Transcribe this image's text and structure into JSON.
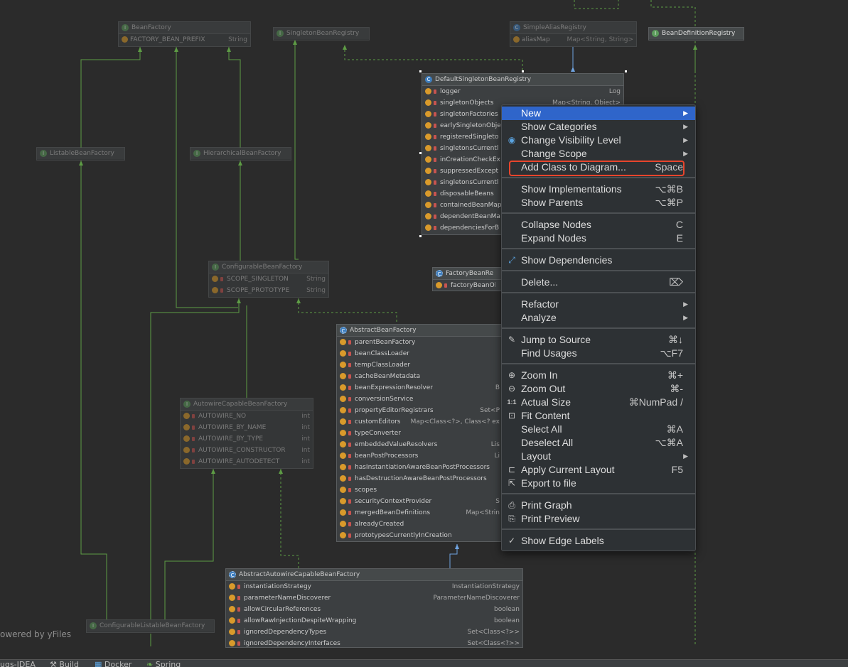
{
  "diagram": {
    "watermark": "owered by yFiles",
    "nodes": {
      "bean_factory": {
        "title": "BeanFactory",
        "fields": [
          {
            "name": "FACTORY_BEAN_PREFIX",
            "type": "String"
          }
        ]
      },
      "singleton_bean_registry": {
        "title": "SingletonBeanRegistry"
      },
      "simple_alias_registry": {
        "title": "SimpleAliasRegistry",
        "fields": [
          {
            "name": "aliasMap",
            "type": "Map<String, String>"
          }
        ]
      },
      "bean_definition_registry": {
        "title": "BeanDefinitionRegistry"
      },
      "listable_bean_factory": {
        "title": "ListableBeanFactory"
      },
      "hierarchical_bean_factory": {
        "title": "HierarchicalBeanFactory"
      },
      "default_singleton_bean_registry": {
        "title": "DefaultSingletonBeanRegistry",
        "fields": [
          {
            "name": "logger",
            "type": "Log"
          },
          {
            "name": "singletonObjects",
            "type": "Map<String, Object>"
          },
          {
            "name": "singletonFactories",
            "type": ""
          },
          {
            "name": "earlySingletonObje",
            "type": ""
          },
          {
            "name": "registeredSingleto",
            "type": ""
          },
          {
            "name": "singletonsCurrentl",
            "type": ""
          },
          {
            "name": "inCreationCheckEx",
            "type": ""
          },
          {
            "name": "suppressedExcept",
            "type": ""
          },
          {
            "name": "singletonsCurrentl",
            "type": ""
          },
          {
            "name": "disposableBeans",
            "type": ""
          },
          {
            "name": "containedBeanMap",
            "type": ""
          },
          {
            "name": "dependentBeanMa",
            "type": ""
          },
          {
            "name": "dependenciesForB",
            "type": ""
          }
        ]
      },
      "configurable_bean_factory": {
        "title": "ConfigurableBeanFactory",
        "fields": [
          {
            "name": "SCOPE_SINGLETON",
            "type": "String"
          },
          {
            "name": "SCOPE_PROTOTYPE",
            "type": "String"
          }
        ]
      },
      "factory_bean_registry": {
        "title": "FactoryBeanRe",
        "fields": [
          {
            "name": "factoryBeanOb",
            "type": ""
          }
        ]
      },
      "abstract_bean_factory": {
        "title": "AbstractBeanFactory",
        "fields": [
          {
            "name": "parentBeanFactory",
            "type": ""
          },
          {
            "name": "beanClassLoader",
            "type": ""
          },
          {
            "name": "tempClassLoader",
            "type": ""
          },
          {
            "name": "cacheBeanMetadata",
            "type": ""
          },
          {
            "name": "beanExpressionResolver",
            "type": "B"
          },
          {
            "name": "conversionService",
            "type": ""
          },
          {
            "name": "propertyEditorRegistrars",
            "type": "Set<P"
          },
          {
            "name": "customEditors",
            "type": "Map<Class<?>, Class<? ex"
          },
          {
            "name": "typeConverter",
            "type": ""
          },
          {
            "name": "embeddedValueResolvers",
            "type": "Lis"
          },
          {
            "name": "beanPostProcessors",
            "type": "Li"
          },
          {
            "name": "hasInstantiationAwareBeanPostProcessors",
            "type": ""
          },
          {
            "name": "hasDestructionAwareBeanPostProcessors",
            "type": ""
          },
          {
            "name": "scopes",
            "type": ""
          },
          {
            "name": "securityContextProvider",
            "type": "S"
          },
          {
            "name": "mergedBeanDefinitions",
            "type": "Map<Strin"
          },
          {
            "name": "alreadyCreated",
            "type": ""
          },
          {
            "name": "prototypesCurrentlyInCreation",
            "type": ""
          }
        ]
      },
      "autowire_capable_bean_factory": {
        "title": "AutowireCapableBeanFactory",
        "fields": [
          {
            "name": "AUTOWIRE_NO",
            "type": "int"
          },
          {
            "name": "AUTOWIRE_BY_NAME",
            "type": "int"
          },
          {
            "name": "AUTOWIRE_BY_TYPE",
            "type": "int"
          },
          {
            "name": "AUTOWIRE_CONSTRUCTOR",
            "type": "int"
          },
          {
            "name": "AUTOWIRE_AUTODETECT",
            "type": "int"
          }
        ]
      },
      "abstract_autowire_capable_bean_factory": {
        "title": "AbstractAutowireCapableBeanFactory",
        "fields": [
          {
            "name": "instantiationStrategy",
            "type": "InstantiationStrategy"
          },
          {
            "name": "parameterNameDiscoverer",
            "type": "ParameterNameDiscoverer"
          },
          {
            "name": "allowCircularReferences",
            "type": "boolean"
          },
          {
            "name": "allowRawInjectionDespiteWrapping",
            "type": "boolean"
          },
          {
            "name": "ignoredDependencyTypes",
            "type": "Set<Class<?>>"
          },
          {
            "name": "ignoredDependencyInterfaces",
            "type": "Set<Class<?>>"
          }
        ]
      },
      "configurable_listable_bean_factory": {
        "title": "ConfigurableListableBeanFactory"
      }
    }
  },
  "context_menu": {
    "items": [
      {
        "label": "New",
        "shortcut": "",
        "submenu": true,
        "icon": ""
      },
      {
        "label": "Show Categories",
        "shortcut": "",
        "submenu": true,
        "icon": ""
      },
      {
        "label": "Change Visibility Level",
        "shortcut": "",
        "submenu": true,
        "icon": "visibility-icon"
      },
      {
        "label": "Change Scope",
        "shortcut": "",
        "submenu": true,
        "icon": ""
      },
      {
        "label": "Add Class to Diagram...",
        "shortcut": "Space",
        "submenu": false,
        "icon": ""
      },
      {
        "label": "Show Implementations",
        "shortcut": "⌥⌘B",
        "submenu": false,
        "icon": ""
      },
      {
        "label": "Show Parents",
        "shortcut": "⌥⌘P",
        "submenu": false,
        "icon": ""
      },
      {
        "label": "Collapse Nodes",
        "shortcut": "C",
        "submenu": false,
        "icon": ""
      },
      {
        "label": "Expand Nodes",
        "shortcut": "E",
        "submenu": false,
        "icon": ""
      },
      {
        "label": "Show Dependencies",
        "shortcut": "",
        "submenu": false,
        "icon": "dependencies-icon"
      },
      {
        "label": "Delete...",
        "shortcut": "⌦",
        "submenu": false,
        "icon": ""
      },
      {
        "label": "Refactor",
        "shortcut": "",
        "submenu": true,
        "icon": ""
      },
      {
        "label": "Analyze",
        "shortcut": "",
        "submenu": true,
        "icon": ""
      },
      {
        "label": "Jump to Source",
        "shortcut": "⌘↓",
        "submenu": false,
        "icon": "pencil-icon"
      },
      {
        "label": "Find Usages",
        "shortcut": "⌥F7",
        "submenu": false,
        "icon": ""
      },
      {
        "label": "Zoom In",
        "shortcut": "⌘+",
        "submenu": false,
        "icon": "zoom-in-icon"
      },
      {
        "label": "Zoom Out",
        "shortcut": "⌘-",
        "submenu": false,
        "icon": "zoom-out-icon"
      },
      {
        "label": "Actual Size",
        "shortcut": "⌘NumPad /",
        "submenu": false,
        "icon": "actual-size-icon"
      },
      {
        "label": "Fit Content",
        "shortcut": "",
        "submenu": false,
        "icon": "fit-content-icon"
      },
      {
        "label": "Select All",
        "shortcut": "⌘A",
        "submenu": false,
        "icon": ""
      },
      {
        "label": "Deselect All",
        "shortcut": "⌥⌘A",
        "submenu": false,
        "icon": ""
      },
      {
        "label": "Layout",
        "shortcut": "",
        "submenu": true,
        "icon": ""
      },
      {
        "label": "Apply Current Layout",
        "shortcut": "F5",
        "submenu": false,
        "icon": "layout-icon"
      },
      {
        "label": "Export to file",
        "shortcut": "",
        "submenu": false,
        "icon": "export-icon"
      },
      {
        "label": "Print Graph",
        "shortcut": "",
        "submenu": false,
        "icon": "print-icon"
      },
      {
        "label": "Print Preview",
        "shortcut": "",
        "submenu": false,
        "icon": "print-preview-icon"
      },
      {
        "label": "Show Edge Labels",
        "shortcut": "",
        "submenu": false,
        "icon": "check-icon"
      }
    ]
  },
  "statusbar": {
    "items": [
      {
        "label": "ugs-IDEA",
        "icon": ""
      },
      {
        "label": "Build",
        "icon": "hammer-icon"
      },
      {
        "label": "Docker",
        "icon": "docker-icon"
      },
      {
        "label": "Spring",
        "icon": "spring-icon"
      }
    ]
  }
}
